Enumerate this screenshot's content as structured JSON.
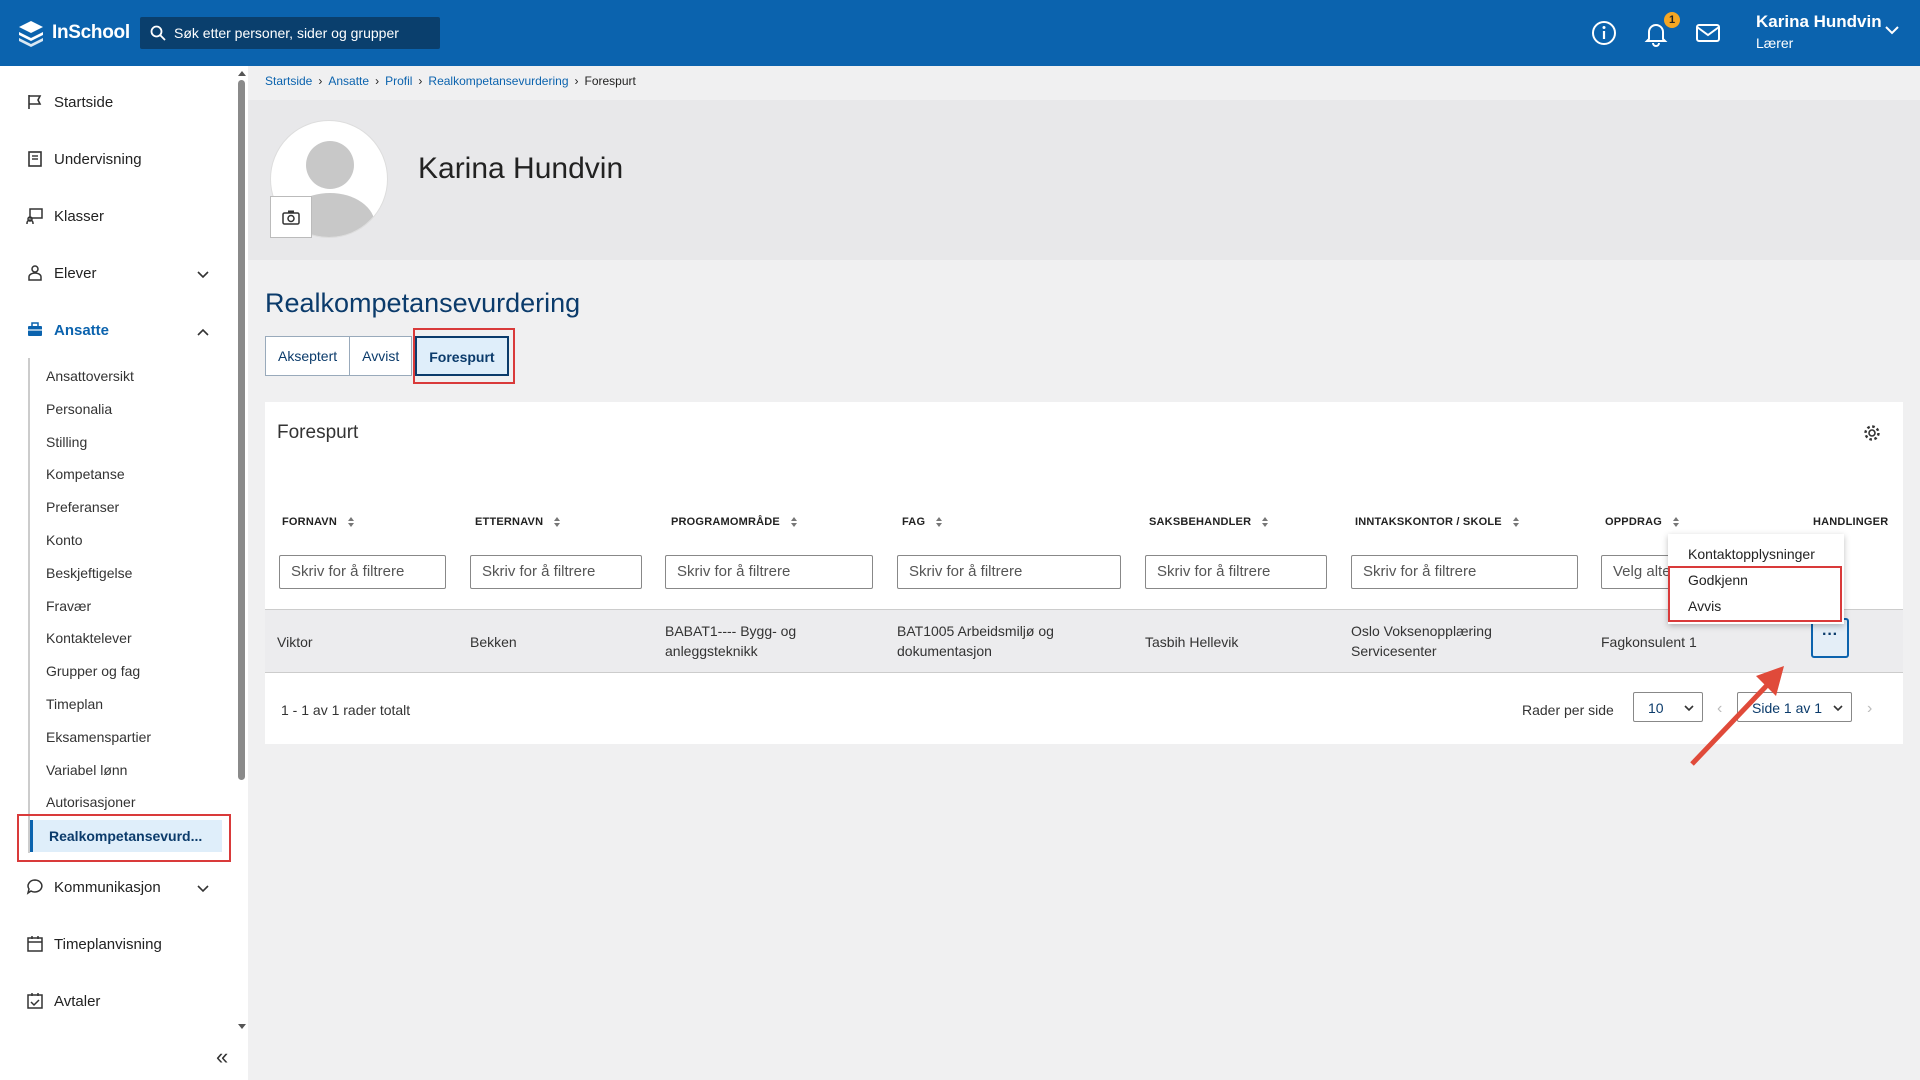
{
  "header": {
    "logo_text": "InSchool",
    "search_placeholder": "Søk etter personer, sider og grupper",
    "notification_count": "1",
    "user_name": "Karina Hundvin",
    "user_role": "Lærer"
  },
  "sidebar": {
    "items": [
      {
        "label": "Startside",
        "icon": "flag-icon"
      },
      {
        "label": "Undervisning",
        "icon": "book-icon"
      },
      {
        "label": "Klasser",
        "icon": "class-icon"
      },
      {
        "label": "Elever",
        "icon": "students-icon"
      },
      {
        "label": "Ansatte",
        "icon": "briefcase-icon"
      },
      {
        "label": "Kommunikasjon",
        "icon": "chat-icon"
      },
      {
        "label": "Timeplanvisning",
        "icon": "calendar-icon"
      },
      {
        "label": "Avtaler",
        "icon": "calendar-check-icon"
      }
    ],
    "sub_items": [
      "Ansattoversikt",
      "Personalia",
      "Stilling",
      "Kompetanse",
      "Preferanser",
      "Konto",
      "Beskjeftigelse",
      "Fravær",
      "Kontaktelever",
      "Grupper og fag",
      "Timeplan",
      "Eksamenspartier",
      "Variabel lønn",
      "Autorisasjoner",
      "Realkompetansevurd..."
    ]
  },
  "breadcrumb": [
    "Startside",
    "Ansatte",
    "Profil",
    "Realkompetansevurdering",
    "Forespurt"
  ],
  "profile": {
    "name": "Karina Hundvin"
  },
  "page": {
    "title": "Realkompetansevurdering",
    "tabs": [
      "Akseptert",
      "Avvist",
      "Forespurt"
    ],
    "active_tab": "Forespurt"
  },
  "table": {
    "title": "Forespurt",
    "columns": [
      "FORNAVN",
      "ETTERNAVN",
      "PROGRAMOMRÅDE",
      "FAG",
      "SAKSBEHANDLER",
      "INNTAKSKONTOR / SKOLE",
      "OPPDRAG",
      "HANDLINGER"
    ],
    "filter_placeholder": "Skriv for å filtrere",
    "select_placeholder": "Velg alternativ",
    "rows": [
      {
        "fornavn": "Viktor",
        "etternavn": "Bekken",
        "programomrade_1": "BABAT1---- Bygg- og",
        "programomrade_2": "anleggsteknikk",
        "fag_1": "BAT1005 Arbeidsmiljø og",
        "fag_2": "dokumentasjon",
        "saksbehandler": "Tasbih Hellevik",
        "skole_1": "Oslo Voksenopplæring",
        "skole_2": "Servicesenter",
        "oppdrag": "Fagkonsulent 1",
        "actions_label": "···"
      }
    ],
    "footer_count": "1 - 1 av 1 rader totalt",
    "rows_per_page_label": "Rader per side",
    "rows_per_page_value": "10",
    "page_value": "Side 1 av 1"
  },
  "action_menu": {
    "items": [
      "Kontaktopplysninger",
      "Godkjenn",
      "Avvis"
    ]
  },
  "colors": {
    "brand": "#0b63ae",
    "highlight": "#d93a3a",
    "badge": "#f5a623"
  }
}
